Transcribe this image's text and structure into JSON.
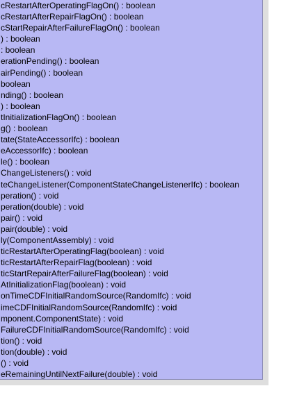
{
  "methods": [
    "cRestartAfterOperatingFlagOn() : boolean",
    "cRestartAfterRepairFlagOn() : boolean",
    "cStartRepairAfterFailureFlagOn() : boolean",
    ") : boolean",
    " : boolean",
    "erationPending() : boolean",
    "airPending() : boolean",
    "boolean",
    "nding() : boolean",
    ") : boolean",
    "tInitializationFlagOn() : boolean",
    "g() : boolean",
    "tate(StateAccessorIfc) : boolean",
    "eAccessorIfc) : boolean",
    "le() : boolean",
    "ChangeListeners() : void",
    "teChangeListener(ComponentStateChangeListenerIfc) : boolean",
    "peration() : void",
    "peration(double) : void",
    "pair() : void",
    "pair(double) : void",
    "ly(ComponentAssembly) : void",
    "ticRestartAfterOperatingFlag(boolean) : void",
    "ticRestartAfterRepairFlag(boolean) : void",
    "ticStartRepairAfterFailureFlag(boolean) : void",
    "AtInitializationFlag(boolean) : void",
    "onTimeCDFInitialRandomSource(RandomIfc) : void",
    "imeCDFInitialRandomSource(RandomIfc) : void",
    "mponent.ComponentState) : void",
    "FailureCDFInitialRandomSource(RandomIfc) : void",
    "tion() : void",
    "tion(double) : void",
    "() : void",
    "eRemainingUntilNextFailure(double) : void"
  ]
}
